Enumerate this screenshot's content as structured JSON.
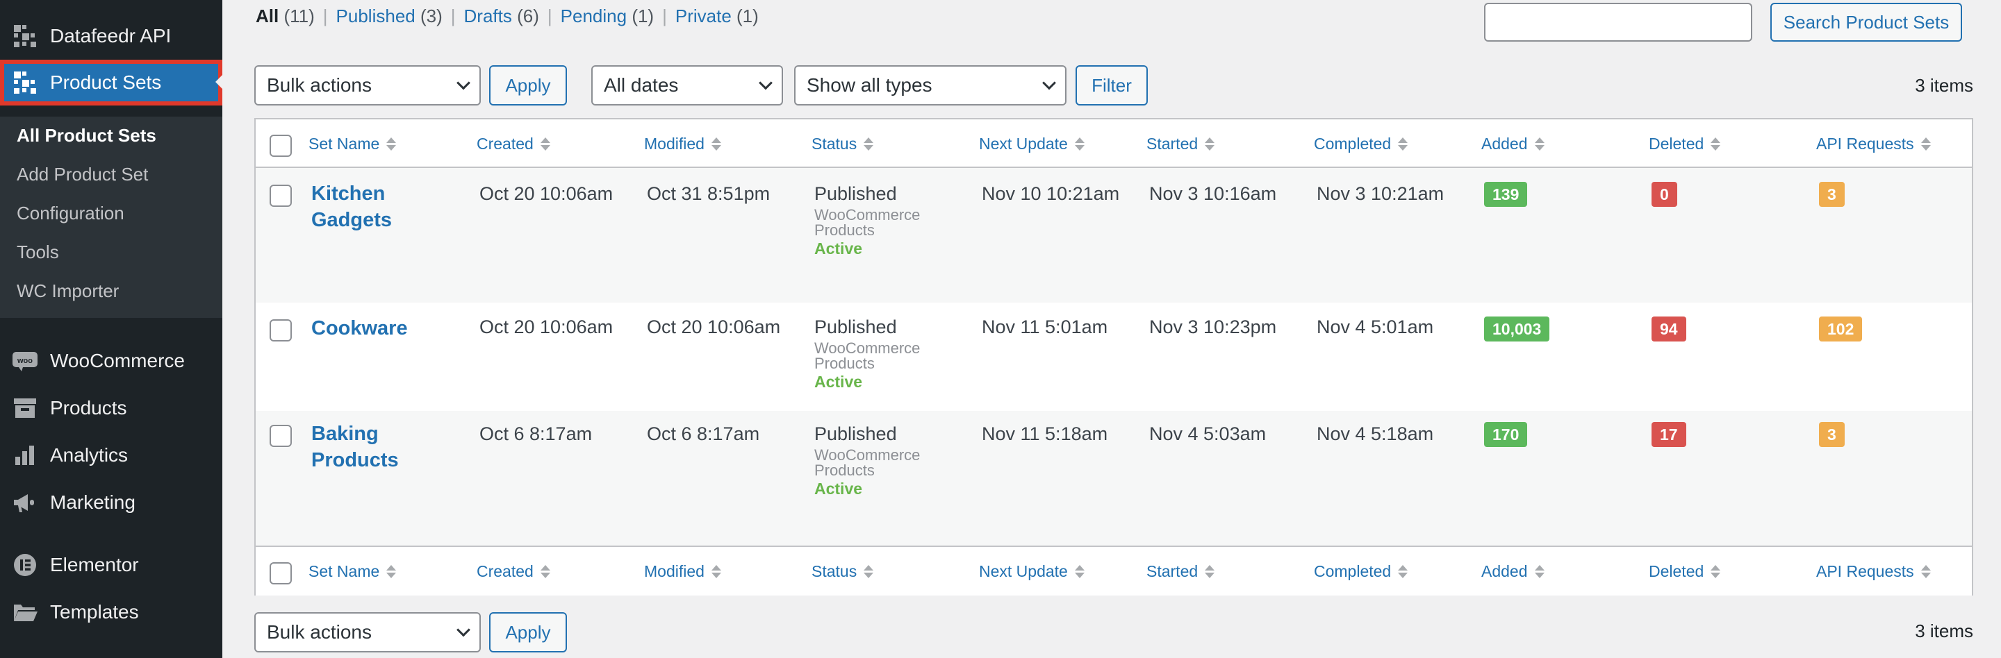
{
  "sidebar": {
    "items": [
      {
        "label": "Datafeedr API",
        "icon": "datafeedr-icon"
      },
      {
        "label": "Product Sets",
        "icon": "datafeedr-icon"
      },
      {
        "label": "WooCommerce",
        "icon": "woocommerce-icon"
      },
      {
        "label": "Products",
        "icon": "products-icon"
      },
      {
        "label": "Analytics",
        "icon": "analytics-icon"
      },
      {
        "label": "Marketing",
        "icon": "marketing-icon"
      },
      {
        "label": "Elementor",
        "icon": "elementor-icon"
      },
      {
        "label": "Templates",
        "icon": "folder-icon"
      }
    ],
    "submenu": [
      "All Product Sets",
      "Add Product Set",
      "Configuration",
      "Tools",
      "WC Importer"
    ]
  },
  "views": [
    {
      "label": "All",
      "count": "(11)"
    },
    {
      "label": "Published",
      "count": "(3)"
    },
    {
      "label": "Drafts",
      "count": "(6)"
    },
    {
      "label": "Pending",
      "count": "(1)"
    },
    {
      "label": "Private",
      "count": "(1)"
    }
  ],
  "views_sep": "|",
  "search": {
    "button": "Search Product Sets",
    "value": ""
  },
  "toolbar": {
    "bulk_actions": "Bulk actions",
    "apply": "Apply",
    "dates": "All dates",
    "types": "Show all types",
    "filter": "Filter",
    "items_count": "3 items"
  },
  "columns": [
    "Set Name",
    "Created",
    "Modified",
    "Status",
    "Next Update",
    "Started",
    "Completed",
    "Added",
    "Deleted",
    "API Requests"
  ],
  "rows": [
    {
      "name": "Kitchen Gadgets",
      "created": "Oct 20 10:06am",
      "modified": "Oct 31 8:51pm",
      "status": "Published",
      "status_sub": "WooCommerce Products",
      "status_state": "Active",
      "next_update": "Nov 10 10:21am",
      "started": "Nov 3 10:16am",
      "completed": "Nov 3 10:21am",
      "added": "139",
      "deleted": "0",
      "api_requests": "3"
    },
    {
      "name": "Cookware",
      "created": "Oct 20 10:06am",
      "modified": "Oct 20 10:06am",
      "status": "Published",
      "status_sub": "WooCommerce Products",
      "status_state": "Active",
      "next_update": "Nov 11 5:01am",
      "started": "Nov 3 10:23pm",
      "completed": "Nov 4 5:01am",
      "added": "10,003",
      "deleted": "94",
      "api_requests": "102"
    },
    {
      "name": "Baking Products",
      "created": "Oct 6 8:17am",
      "modified": "Oct 6 8:17am",
      "status": "Published",
      "status_sub": "WooCommerce Products",
      "status_state": "Active",
      "next_update": "Nov 11 5:18am",
      "started": "Nov 4 5:03am",
      "completed": "Nov 4 5:18am",
      "added": "170",
      "deleted": "17",
      "api_requests": "3"
    }
  ],
  "colors": {
    "added": "#5cb85c",
    "deleted": "#d9534f",
    "api": "#f0ad4e",
    "accent": "#2271b1"
  }
}
